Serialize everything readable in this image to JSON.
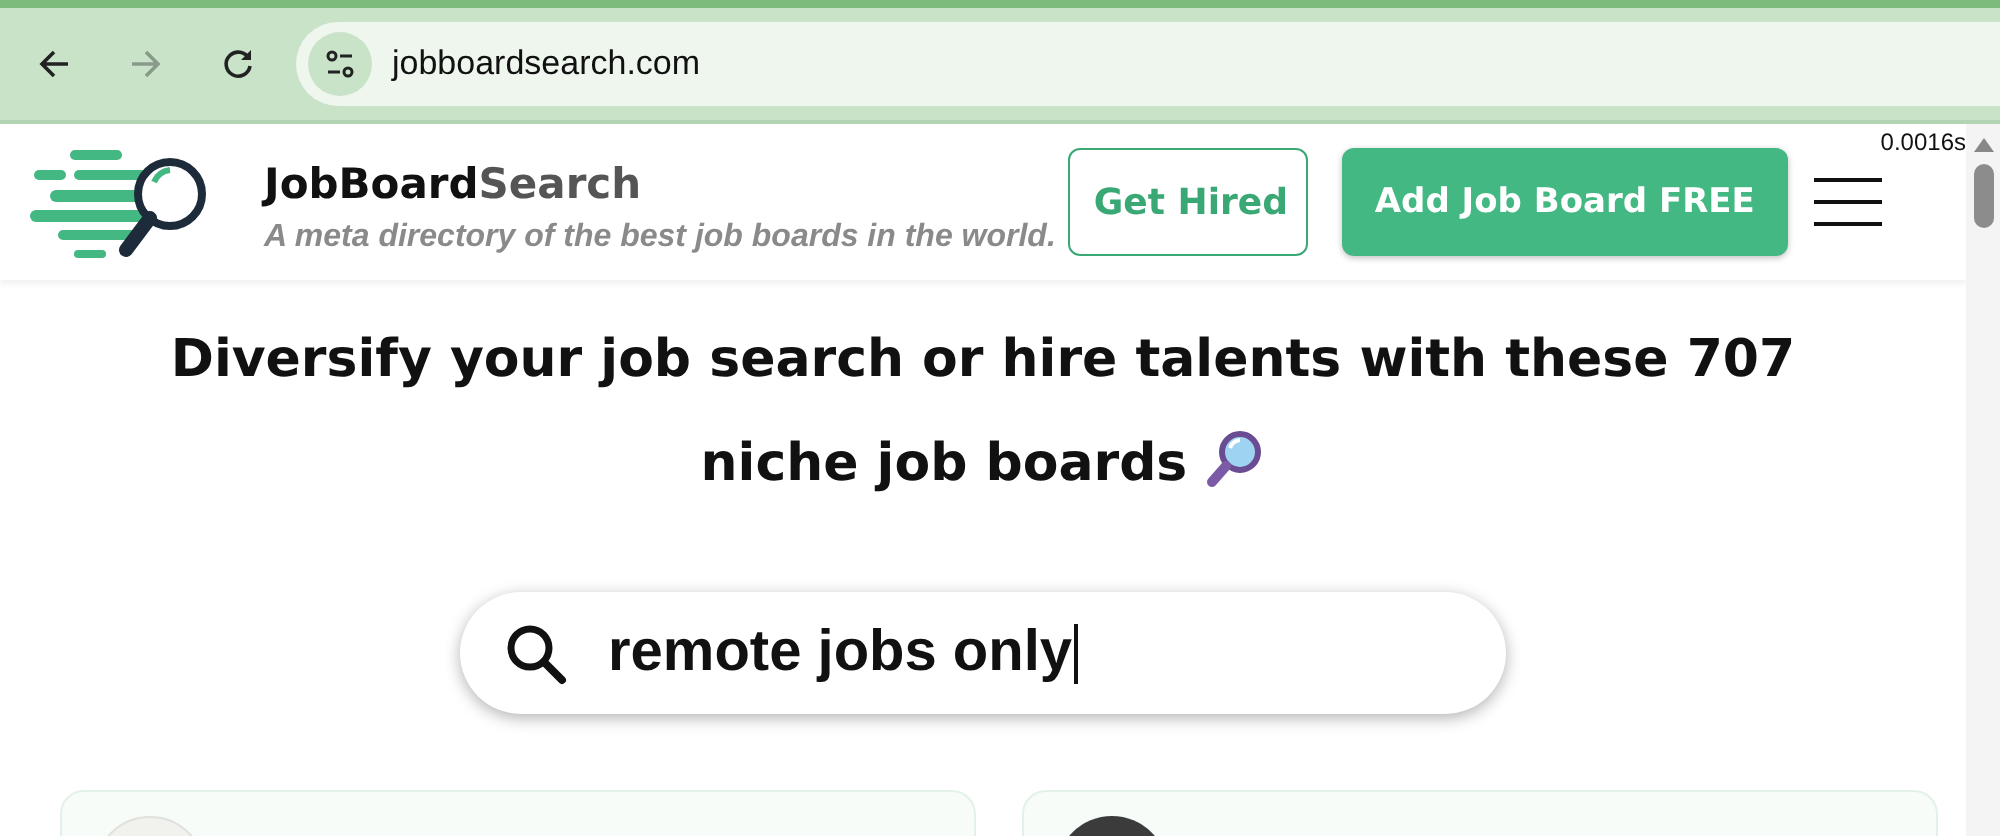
{
  "browser": {
    "back": {
      "disabled": false
    },
    "forward": {
      "disabled": true
    },
    "url": "jobboardsearch.com"
  },
  "header": {
    "brand_strong": "JobBoard",
    "brand_light": "Search",
    "tagline": "A meta directory of the best job boards in the world.",
    "buttons": [
      {
        "label": "Get Hired",
        "kind": "outline"
      },
      {
        "label": "Add Job Board FREE",
        "kind": "solid"
      }
    ],
    "timer": "0.0016s"
  },
  "hero": {
    "heading": "Diversify your job search or hire talents with these 707 niche job boards"
  },
  "search": {
    "value": "remote jobs only",
    "focused": true
  },
  "cards": [
    {
      "kind": "logo"
    },
    {
      "kind": "badge"
    }
  ]
}
